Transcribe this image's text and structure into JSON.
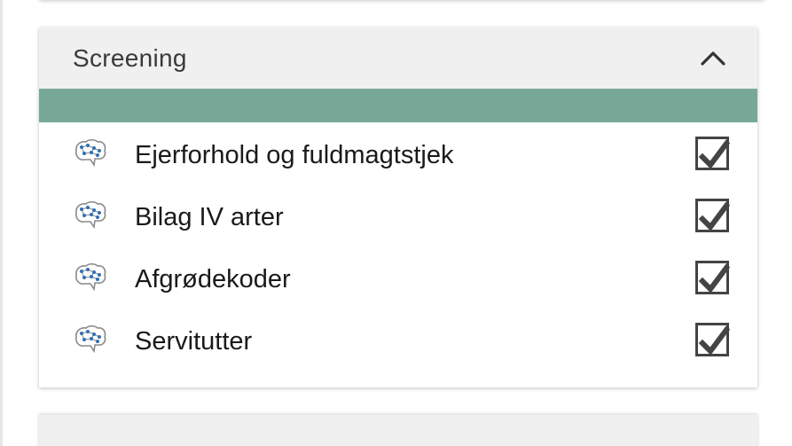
{
  "panel": {
    "title": "Screening",
    "collapse_icon": "chevron-up-icon",
    "accent_color": "#77a898",
    "items": [
      {
        "label": "Ejerforhold og fuldmagtstjek",
        "icon": "brain-network-icon",
        "checked": true
      },
      {
        "label": "Bilag IV arter",
        "icon": "brain-network-icon",
        "checked": true
      },
      {
        "label": "Afgrødekoder",
        "icon": "brain-network-icon",
        "checked": true
      },
      {
        "label": "Servitutter",
        "icon": "brain-network-icon",
        "checked": true
      }
    ]
  }
}
